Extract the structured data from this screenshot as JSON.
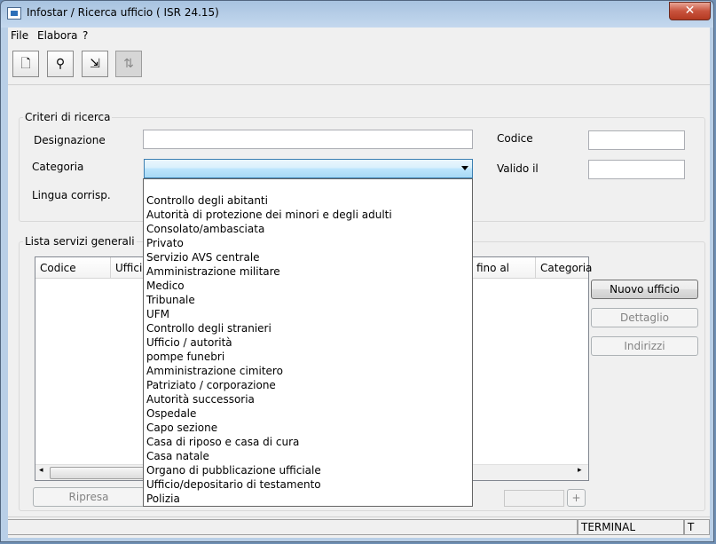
{
  "window": {
    "title": "Infostar / Ricerca ufficio ( ISR 24.15)",
    "close_label": "✕"
  },
  "menu": [
    "File",
    "Elabora",
    "?"
  ],
  "toolbar": {
    "buttons": [
      {
        "icon": "new-document-icon",
        "glyph": "🗋"
      },
      {
        "icon": "binoculars-icon",
        "glyph": "⚲"
      },
      {
        "icon": "export-icon",
        "glyph": "⇲"
      },
      {
        "icon": "sort-az-icon",
        "glyph": "⇅"
      }
    ]
  },
  "criteria": {
    "title": "Criteri di ricerca",
    "designazione_label": "Designazione",
    "designazione_value": "",
    "categoria_label": "Categoria",
    "categoria_value": "",
    "lingua_label": "Lingua corrisp.",
    "codice_label": "Codice",
    "codice_value": "",
    "valido_label": "Valido il",
    "valido_value": ""
  },
  "list": {
    "title": "Lista servizi generali",
    "columns": [
      "Codice",
      "Ufficio",
      "fino al",
      "Categoria"
    ]
  },
  "side_buttons": {
    "nuovo": "Nuovo ufficio",
    "dettaglio": "Dettaglio",
    "indirizzi": "Indirizzi"
  },
  "bottom": {
    "ripresa": "Ripresa",
    "plus": "+"
  },
  "status": {
    "terminal": "TERMINAL",
    "t": "T"
  },
  "categoria_options": [
    "",
    "Controllo degli abitanti",
    "Autorità di protezione dei minori e degli adulti",
    "Consolato/ambasciata",
    "Privato",
    "Servizio AVS centrale",
    "Amministrazione militare",
    "Medico",
    "Tribunale",
    "UFM",
    "Controllo degli stranieri",
    "Ufficio / autorità",
    "pompe funebri",
    "Amministrazione cimitero",
    "Patriziato / corporazione",
    "Autorità successoria",
    "Ospedale",
    "Capo sezione",
    "Casa di riposo e casa di cura",
    "Casa natale",
    "Organo di pubblicazione ufficiale",
    "Ufficio/depositario di testamento",
    "Polizia"
  ]
}
